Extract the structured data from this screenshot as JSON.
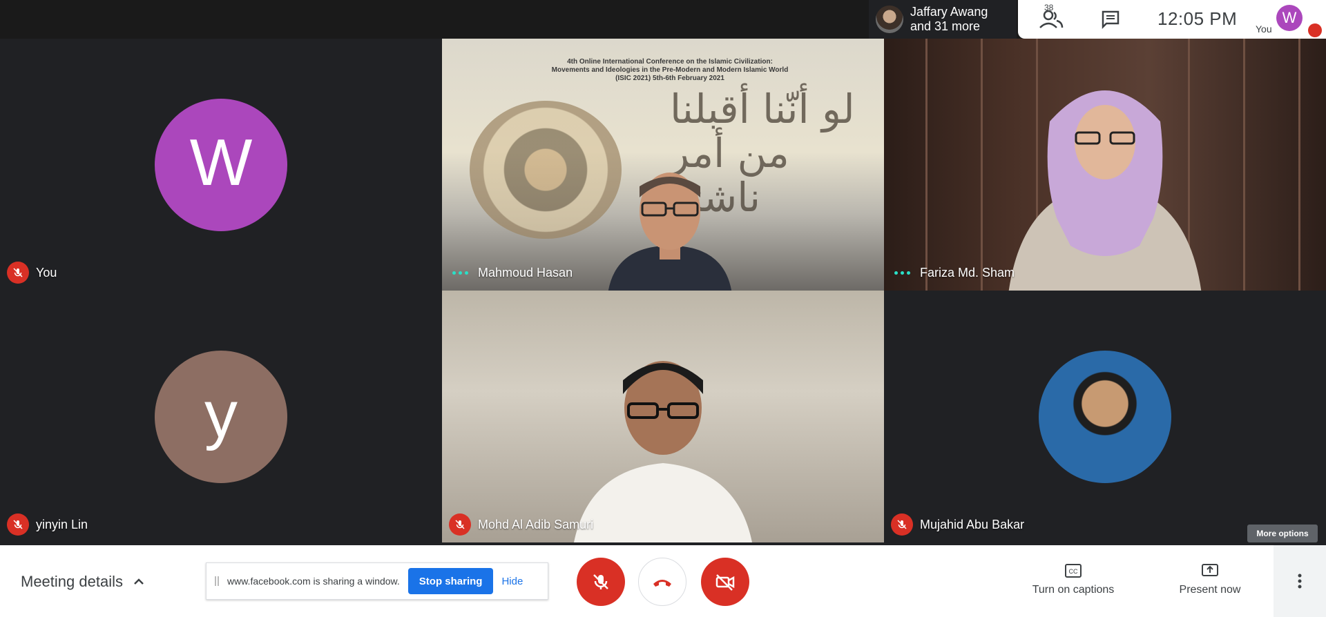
{
  "topbar": {
    "presenter_line1": "Jaffary Awang",
    "presenter_line2": "and 31 more",
    "people_count": "38",
    "clock": "12:05 PM",
    "self_initial": "W",
    "self_label": "You"
  },
  "tiles": [
    {
      "name": "You",
      "initial": "W",
      "avatar_color": "#ab47bc",
      "muted": true
    },
    {
      "name": "Mahmoud Hasan",
      "speaking": true
    },
    {
      "name": "Fariza Md. Sham",
      "speaking": true
    },
    {
      "name": "yinyin Lin",
      "initial": "y",
      "avatar_color": "#8d6e63",
      "muted": true
    },
    {
      "name": "Mohd Al Adib Samuri",
      "muted": true
    },
    {
      "name": "Mujahid Abu Bakar",
      "muted": true
    }
  ],
  "slide": {
    "line1": "4th Online International Conference on the Islamic Civilization:",
    "line2": "Movements and Ideologies in the Pre-Modern and Modern Islamic World",
    "line3": "(ISIC 2021) 5th-6th February 2021"
  },
  "tooltip": {
    "more_options": "More options"
  },
  "bottombar": {
    "meeting_details": "Meeting details",
    "share_text": "www.facebook.com is sharing a window.",
    "stop_sharing": "Stop sharing",
    "hide": "Hide",
    "captions": "Turn on captions",
    "present": "Present now"
  },
  "colors": {
    "danger": "#d93025",
    "accent": "#1a73e8",
    "speaking": "#2ae0c8"
  }
}
